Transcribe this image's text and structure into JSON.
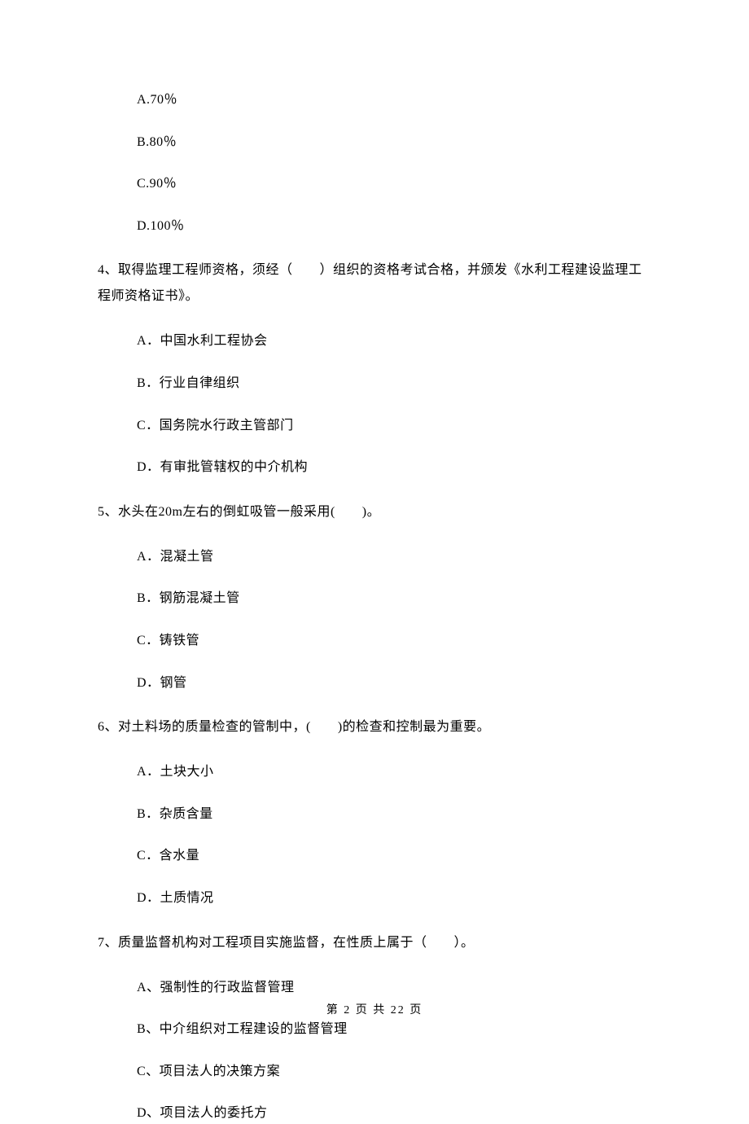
{
  "q3_tail": {
    "options": {
      "a": "A.70％",
      "b": "B.80％",
      "c": "C.90％",
      "d": "D.100％"
    }
  },
  "q4": {
    "text": "4、取得监理工程师资格，须经（　　）组织的资格考试合格，并颁发《水利工程建设监理工程师资格证书》。",
    "options": {
      "a": "A．中国水利工程协会",
      "b": "B．行业自律组织",
      "c": "C．国务院水行政主管部门",
      "d": "D．有审批管辖权的中介机构"
    }
  },
  "q5": {
    "text": "5、水头在20m左右的倒虹吸管一般采用(　　)。",
    "options": {
      "a": "A．混凝土管",
      "b": "B．钢筋混凝土管",
      "c": "C．铸铁管",
      "d": "D．钢管"
    }
  },
  "q6": {
    "text": "6、对土料场的质量检查的管制中，(　　)的检查和控制最为重要。",
    "options": {
      "a": "A．土块大小",
      "b": "B．杂质含量",
      "c": "C．含水量",
      "d": "D．土质情况"
    }
  },
  "q7": {
    "text": "7、质量监督机构对工程项目实施监督，在性质上属于（　　）。",
    "options": {
      "a": "A、强制性的行政监督管理",
      "b": "B、中介组织对工程建设的监督管理",
      "c": "C、项目法人的决策方案",
      "d": "D、项目法人的委托方"
    }
  },
  "footer": "第 2 页 共 22 页"
}
